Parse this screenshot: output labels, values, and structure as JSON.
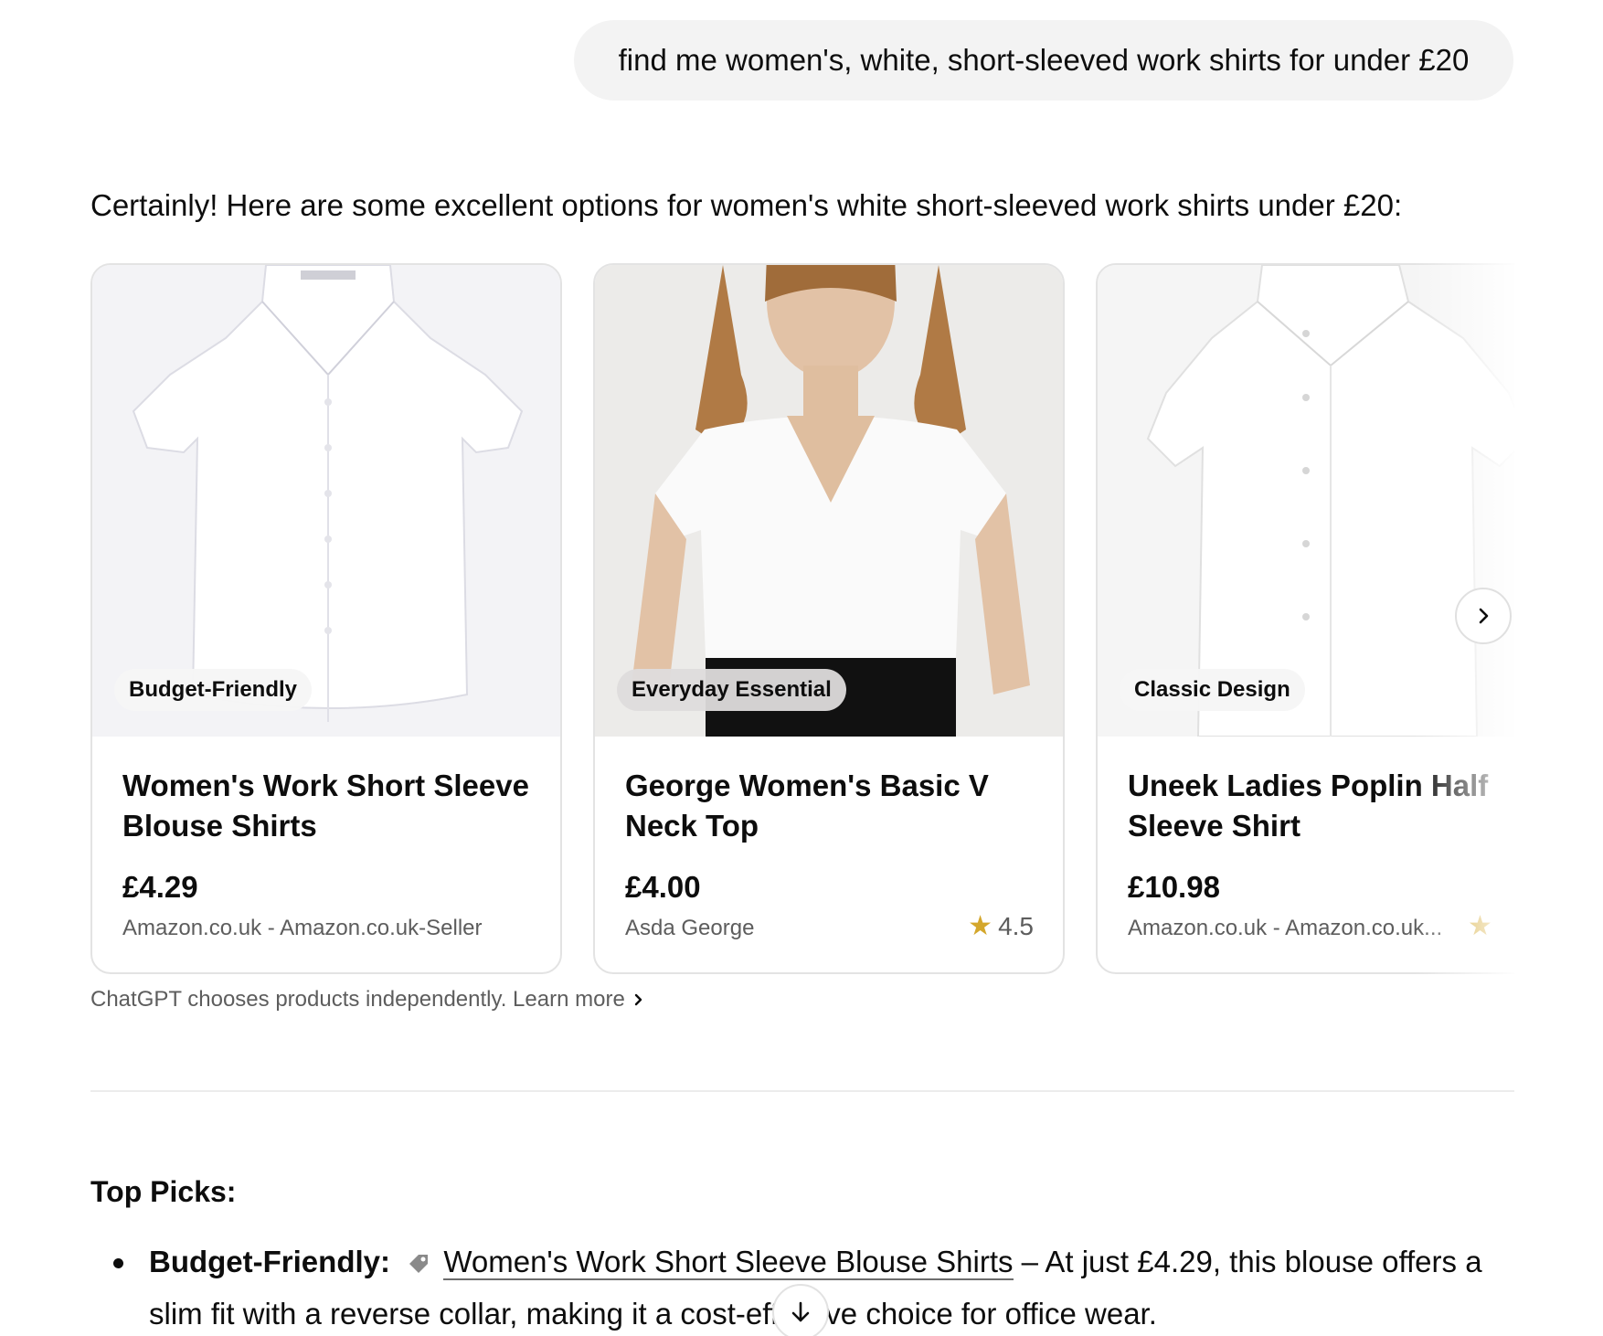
{
  "user_message": "find me women's, white, short-sleeved work shirts for under £20",
  "assistant": {
    "intro": "Certainly! Here are some excellent options for women's white short-sleeved work shirts under £20:",
    "products": [
      {
        "badge": "Budget-Friendly",
        "title": "Women's Work Short Sleeve Blouse Shirts",
        "price": "£4.29",
        "seller": "Amazon.co.uk - Amazon.co.uk-Seller"
      },
      {
        "badge": "Everyday Essential",
        "title": "George Women's Basic V Neck Top",
        "price": "£4.00",
        "seller": "Asda George",
        "rating": "4.5"
      },
      {
        "badge": "Classic Design",
        "title": "Uneek Ladies Poplin Half Sleeve Shirt",
        "price": "£10.98",
        "seller": "Amazon.co.uk - Amazon.co.uk..."
      }
    ],
    "disclaimer": "ChatGPT chooses products independently. Learn more",
    "top_picks_heading": "Top Picks:",
    "picks": [
      {
        "label": "Budget-Friendly:",
        "link": "Women's Work Short Sleeve Blouse Shirts",
        "text": " – At just £4.29, this blouse offers a slim fit with a reverse collar, making it a cost-effective choice for office wear."
      }
    ]
  },
  "icons": {
    "next": "chevron-right-icon",
    "star": "star-icon",
    "tag": "price-tag-icon",
    "scroll": "arrow-down-icon"
  },
  "colors": {
    "star": "#d4a72c",
    "bubble": "#f3f3f3",
    "muted_text": "#5d5d5d"
  }
}
